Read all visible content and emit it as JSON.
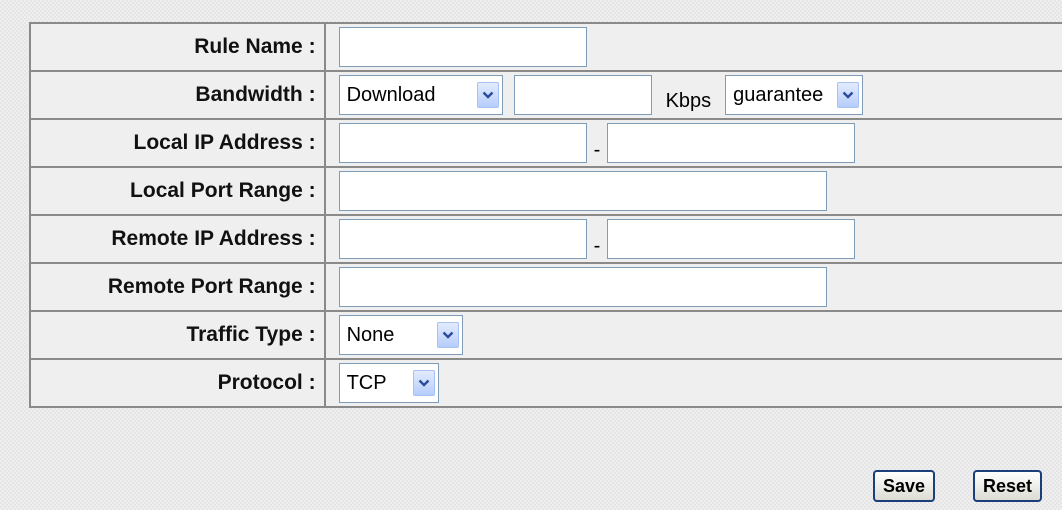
{
  "form": {
    "rule_name": {
      "label": "Rule Name :",
      "value": ""
    },
    "bandwidth": {
      "label": "Bandwidth :",
      "direction_selected": "Download",
      "rate_value": "",
      "unit": "Kbps",
      "mode_selected": "guarantee"
    },
    "local_ip": {
      "label": "Local IP Address :",
      "start": "",
      "separator": "-",
      "end": ""
    },
    "local_port": {
      "label": "Local Port Range :",
      "value": ""
    },
    "remote_ip": {
      "label": "Remote IP Address :",
      "start": "",
      "separator": "-",
      "end": ""
    },
    "remote_port": {
      "label": "Remote Port Range :",
      "value": ""
    },
    "traffic_type": {
      "label": "Traffic Type :",
      "selected": "None"
    },
    "protocol": {
      "label": "Protocol :",
      "selected": "TCP"
    }
  },
  "buttons": {
    "save": "Save",
    "reset": "Reset"
  },
  "icons": {
    "dropdown": "chevron-down-icon"
  },
  "colors": {
    "input_border": "#7f9db9",
    "dropdown_button": "#b6cdfb",
    "table_border": "#8a8a8a",
    "button_border": "#1b3f7a"
  }
}
